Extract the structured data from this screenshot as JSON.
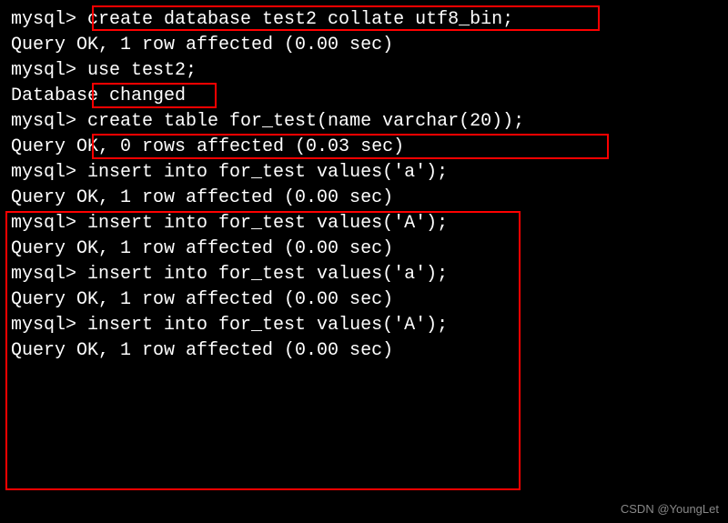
{
  "prompt": "mysql> ",
  "lines": [
    {
      "type": "cmd",
      "text": "create database test2 collate utf8_bin;"
    },
    {
      "type": "result",
      "text": "Query OK, 1 row affected (0.00 sec)"
    },
    {
      "type": "blank",
      "text": ""
    },
    {
      "type": "cmd",
      "text": "use test2;"
    },
    {
      "type": "result",
      "text": "Database changed"
    },
    {
      "type": "cmd",
      "text": "create table for_test(name varchar(20));"
    },
    {
      "type": "result",
      "text": "Query OK, 0 rows affected (0.03 sec)"
    },
    {
      "type": "blank",
      "text": ""
    },
    {
      "type": "cmd",
      "text": "insert into for_test values('a');"
    },
    {
      "type": "result",
      "text": "Query OK, 1 row affected (0.00 sec)"
    },
    {
      "type": "blank",
      "text": ""
    },
    {
      "type": "cmd",
      "text": "insert into for_test values('A');"
    },
    {
      "type": "result",
      "text": "Query OK, 1 row affected (0.00 sec)"
    },
    {
      "type": "blank",
      "text": ""
    },
    {
      "type": "cmd",
      "text": "insert into for_test values('a');"
    },
    {
      "type": "result",
      "text": "Query OK, 1 row affected (0.00 sec)"
    },
    {
      "type": "blank",
      "text": ""
    },
    {
      "type": "cmd",
      "text": "insert into for_test values('A');"
    },
    {
      "type": "result",
      "text": "Query OK, 1 row affected (0.00 sec)"
    }
  ],
  "watermark": "CSDN @YoungLet"
}
